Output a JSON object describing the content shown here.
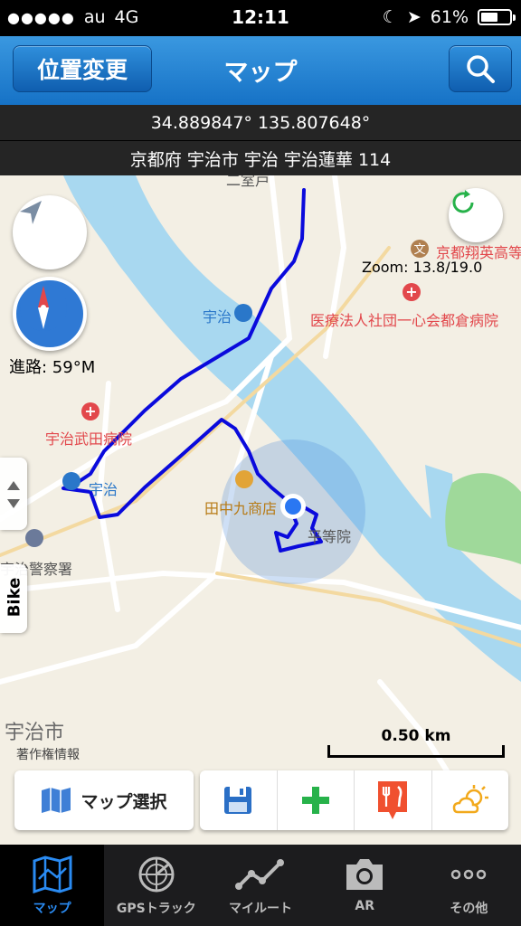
{
  "status_bar": {
    "carrier": "au",
    "network": "4G",
    "time": "12:11",
    "battery": "61%",
    "battery_level": 0.61
  },
  "navbar": {
    "location_button": "位置変更",
    "title": "マップ",
    "search_icon": "search-icon"
  },
  "info": {
    "coordinates": "34.889847° 135.807648°",
    "address": "京都府 宇治市 宇治 宇治蓮華 114"
  },
  "map": {
    "zoom": "Zoom: 13.8/19.0",
    "course": "進路: 59°M",
    "scale": "0.50 km",
    "copyright": "著作権情報",
    "side_tab": "Bike",
    "labels": {
      "school": "京都翔英高等",
      "hospital": "医療法人社団一心会都倉病院",
      "uji_station_top": "宇治",
      "uji_station_left": "宇治",
      "takeda_hospital": "宇治武田病院",
      "tanaka": "田中九商店",
      "byodoin": "平等院",
      "police": "宇治警察署",
      "city": "宇治市",
      "top_fragment": "二室戸"
    }
  },
  "toolbar": {
    "map_select": "マップ選択",
    "tools": [
      "save-icon",
      "add-icon",
      "restaurant-icon",
      "weather-icon"
    ]
  },
  "tabs": [
    {
      "label": "マップ",
      "icon": "map-icon",
      "active": true
    },
    {
      "label": "GPSトラック",
      "icon": "radar-icon",
      "active": false
    },
    {
      "label": "マイルート",
      "icon": "route-icon",
      "active": false
    },
    {
      "label": "AR",
      "icon": "camera-icon",
      "active": false
    },
    {
      "label": "その他",
      "icon": "more-icon",
      "active": false
    }
  ],
  "colors": {
    "navbar": "#1f7fd0",
    "track": "#0a0adc",
    "water": "#a8d8f0",
    "park": "#9fd99a",
    "active_tab": "#2a8bf2"
  }
}
